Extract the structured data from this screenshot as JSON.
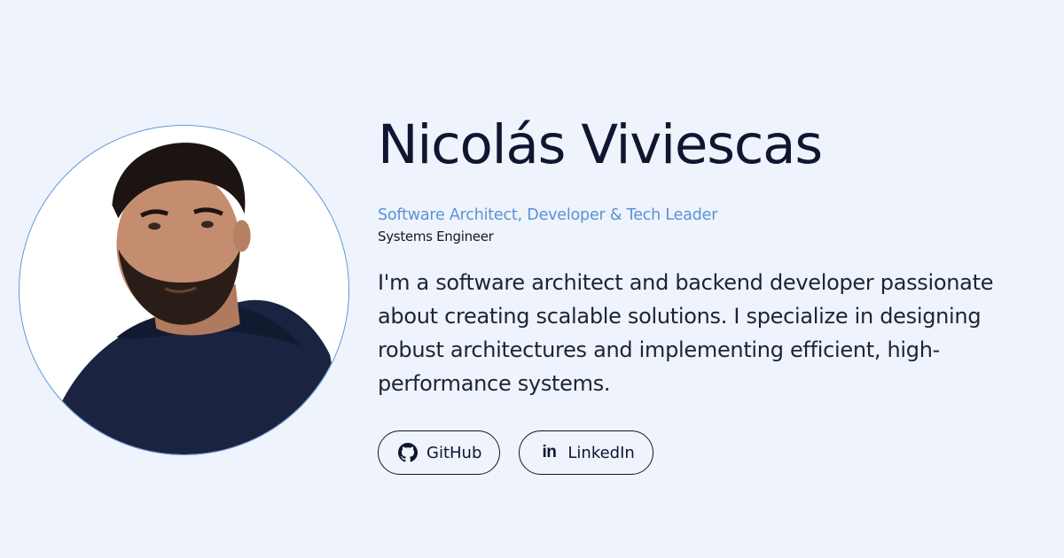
{
  "profile": {
    "name": "Nicolás Viviescas",
    "role": "Software Architect, Developer & Tech Leader",
    "degree": "Systems Engineer",
    "bio": "I'm a software architect and backend developer passionate about creating scalable solutions. I specialize in designing robust architectures and implementing efficient, high-performance systems.",
    "avatar_alt": "Profile photo"
  },
  "links": {
    "github": {
      "label": "GitHub",
      "icon": "github-icon"
    },
    "linkedin": {
      "label": "LinkedIn",
      "icon": "linkedin-icon",
      "icon_text": "in"
    }
  },
  "colors": {
    "background": "#eef3fc",
    "accent": "#5a92d4",
    "text": "#0f1630"
  }
}
